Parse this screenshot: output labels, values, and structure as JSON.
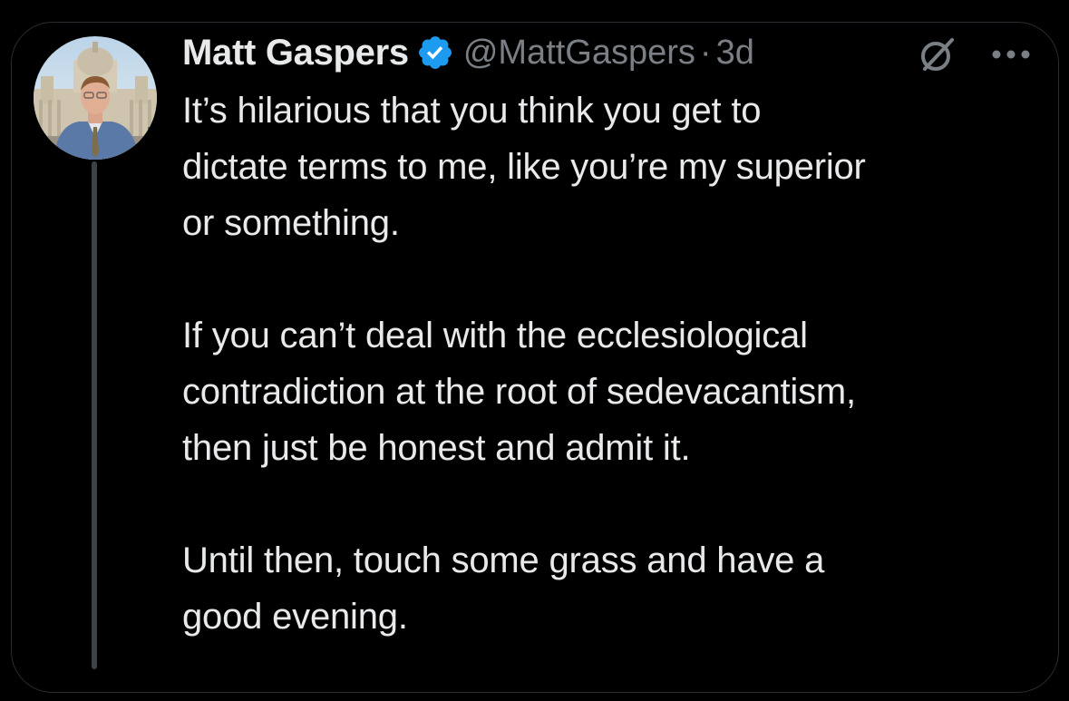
{
  "tweet": {
    "display_name": "Matt Gaspers",
    "handle": "@MattGaspers",
    "separator": "·",
    "time": "3d",
    "verified": true,
    "avatar_icon": "profile-photo",
    "menu_icon": "more-horizontal-icon",
    "grok_icon": "grok-icon",
    "paragraphs": [
      "It’s hilarious that you think you get to\ndictate terms to me, like you’re my superior\nor something.",
      "If you can’t deal with the ecclesiological\ncontradiction at the root of sedevacantism,\nthen just be honest and admit it.",
      "Until then, touch some grass and have a\ngood evening."
    ]
  },
  "colors": {
    "background": "#000000",
    "primary_text": "#e7e9ea",
    "secondary_text": "#7a7f85",
    "verified_blue": "#1d9bf0",
    "thread_line": "#3c4147"
  }
}
